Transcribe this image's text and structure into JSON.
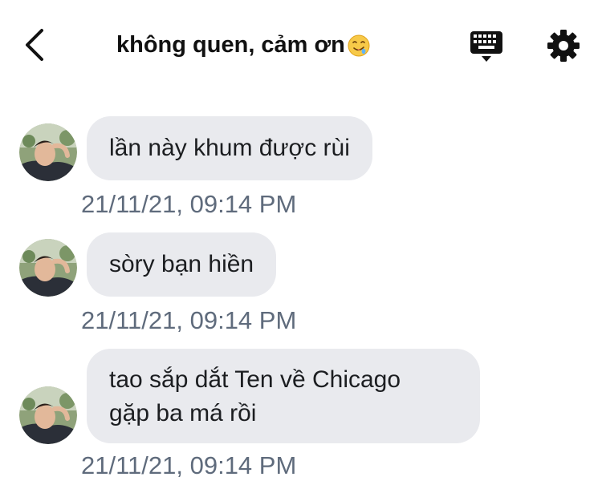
{
  "header": {
    "title": "không quen, cảm ơn",
    "back_icon": "chevron-left-icon",
    "title_emoji_icon": "drooling-face-emoji-icon",
    "keyboard_icon": "keyboard-icon",
    "settings_icon": "gear-icon"
  },
  "messages": [
    {
      "text": "lần này khum được rùi",
      "timestamp": "21/11/21, 09:14 PM"
    },
    {
      "text": "sòry bạn hiền",
      "timestamp": "21/11/21, 09:14 PM"
    },
    {
      "line1": "tao sắp dắt Ten về Chicago",
      "line2": "gặp ba má rồi",
      "timestamp": "21/11/21, 09:14 PM"
    }
  ],
  "colors": {
    "bubble_bg": "#e9eaee",
    "timestamp": "#5f6b7c",
    "text": "#1c1e21"
  }
}
